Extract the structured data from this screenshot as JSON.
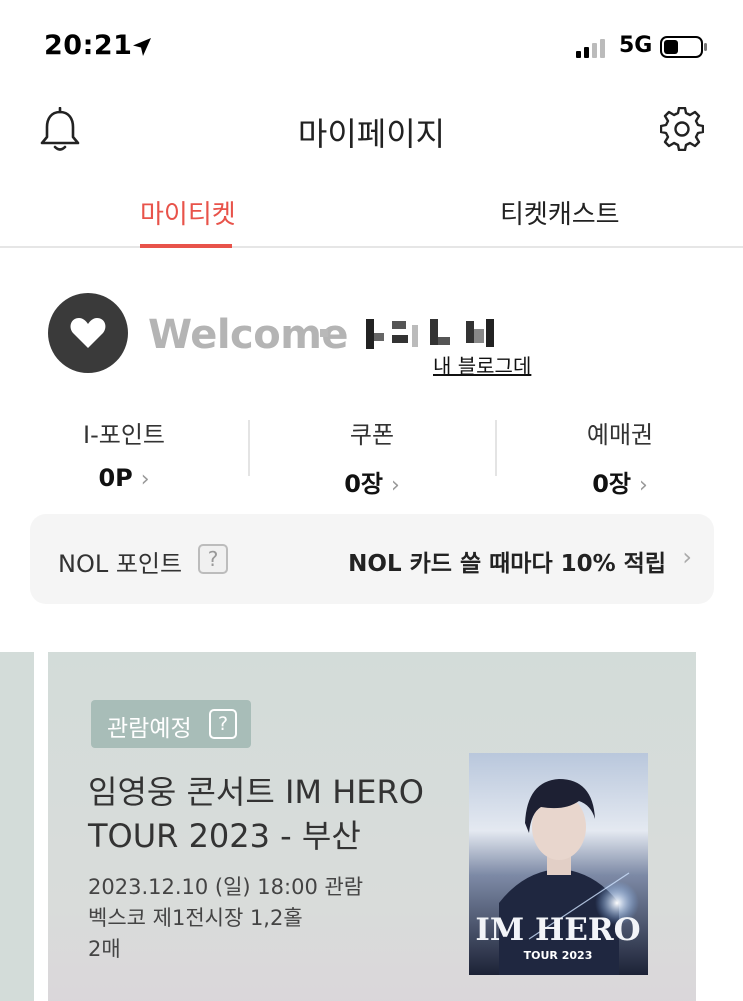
{
  "status_bar": {
    "time": "20:21",
    "network": "5G"
  },
  "header": {
    "title": "마이페이지"
  },
  "tabs": [
    {
      "label": "마이티켓",
      "active": true
    },
    {
      "label": "티켓캐스트",
      "active": false
    }
  ],
  "profile": {
    "welcome": "Welcome",
    "blog_link": "내 블로그데"
  },
  "stats": [
    {
      "label": "I-포인트",
      "value": "0P"
    },
    {
      "label": "쿠폰",
      "value": "0장"
    },
    {
      "label": "예매권",
      "value": "0장"
    }
  ],
  "nol": {
    "label": "NOL 포인트",
    "help": "?",
    "promo": "NOL 카드 쓸 때마다 10% 적립"
  },
  "ticket": {
    "badge": "관람예정",
    "badge_help": "?",
    "title": "임영웅 콘서트 IM HERO TOUR 2023 - 부산",
    "datetime": "2023.12.10 (일)  18:00 관람",
    "venue": "벡스코 제1전시장 1,2홀",
    "count": "2매",
    "poster": {
      "title": "IM HERO",
      "subtitle": "TOUR 2023"
    }
  },
  "colors": {
    "accent": "#e8534a",
    "badge": "#a8bdb8",
    "card": "#d3dcd9"
  }
}
